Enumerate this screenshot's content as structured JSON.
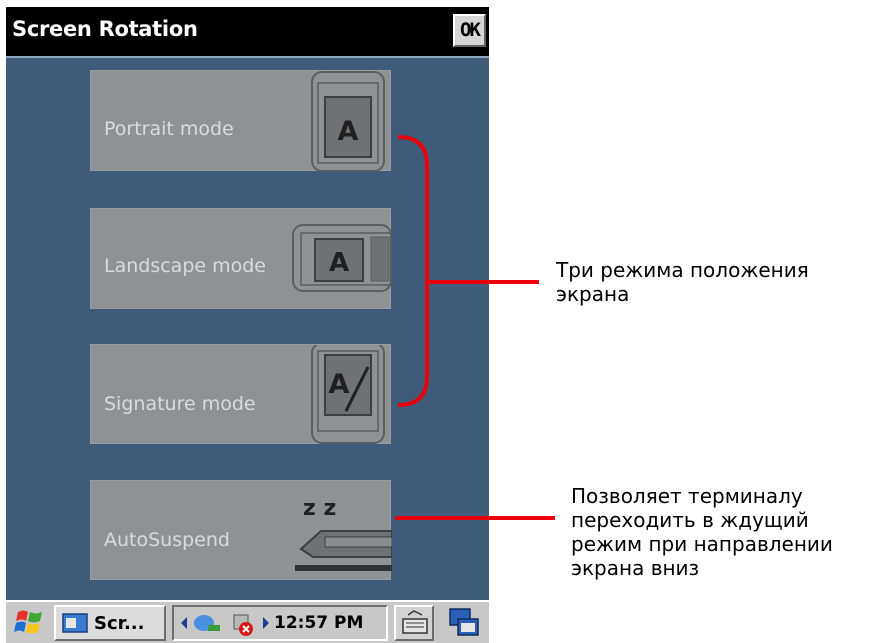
{
  "window": {
    "title": "Screen Rotation",
    "ok_label": "OK"
  },
  "modes": [
    {
      "label": "Portrait mode",
      "icon": "portrait-device-icon",
      "glyph": "A"
    },
    {
      "label": "Landscape mode",
      "icon": "landscape-device-icon",
      "glyph": "A"
    },
    {
      "label": "Signature mode",
      "icon": "signature-device-icon",
      "glyph": "A"
    },
    {
      "label": "AutoSuspend",
      "icon": "sleep-device-icon",
      "glyph": "z z"
    }
  ],
  "taskbar": {
    "task_label": "Scr...",
    "clock": "12:57 PM"
  },
  "annotations": {
    "modes_note_line1": "Три режима положения",
    "modes_note_line2": "экрана",
    "suspend_note_line1": "Позволяет терминалу",
    "suspend_note_line2": "переходить в ждущий",
    "suspend_note_line3": "режим при направлении",
    "suspend_note_line4": "экрана вниз"
  },
  "colors": {
    "screen_bg": "#3e5c79",
    "button_bg": "#8f9194",
    "annotation_line": "#e8000a"
  }
}
